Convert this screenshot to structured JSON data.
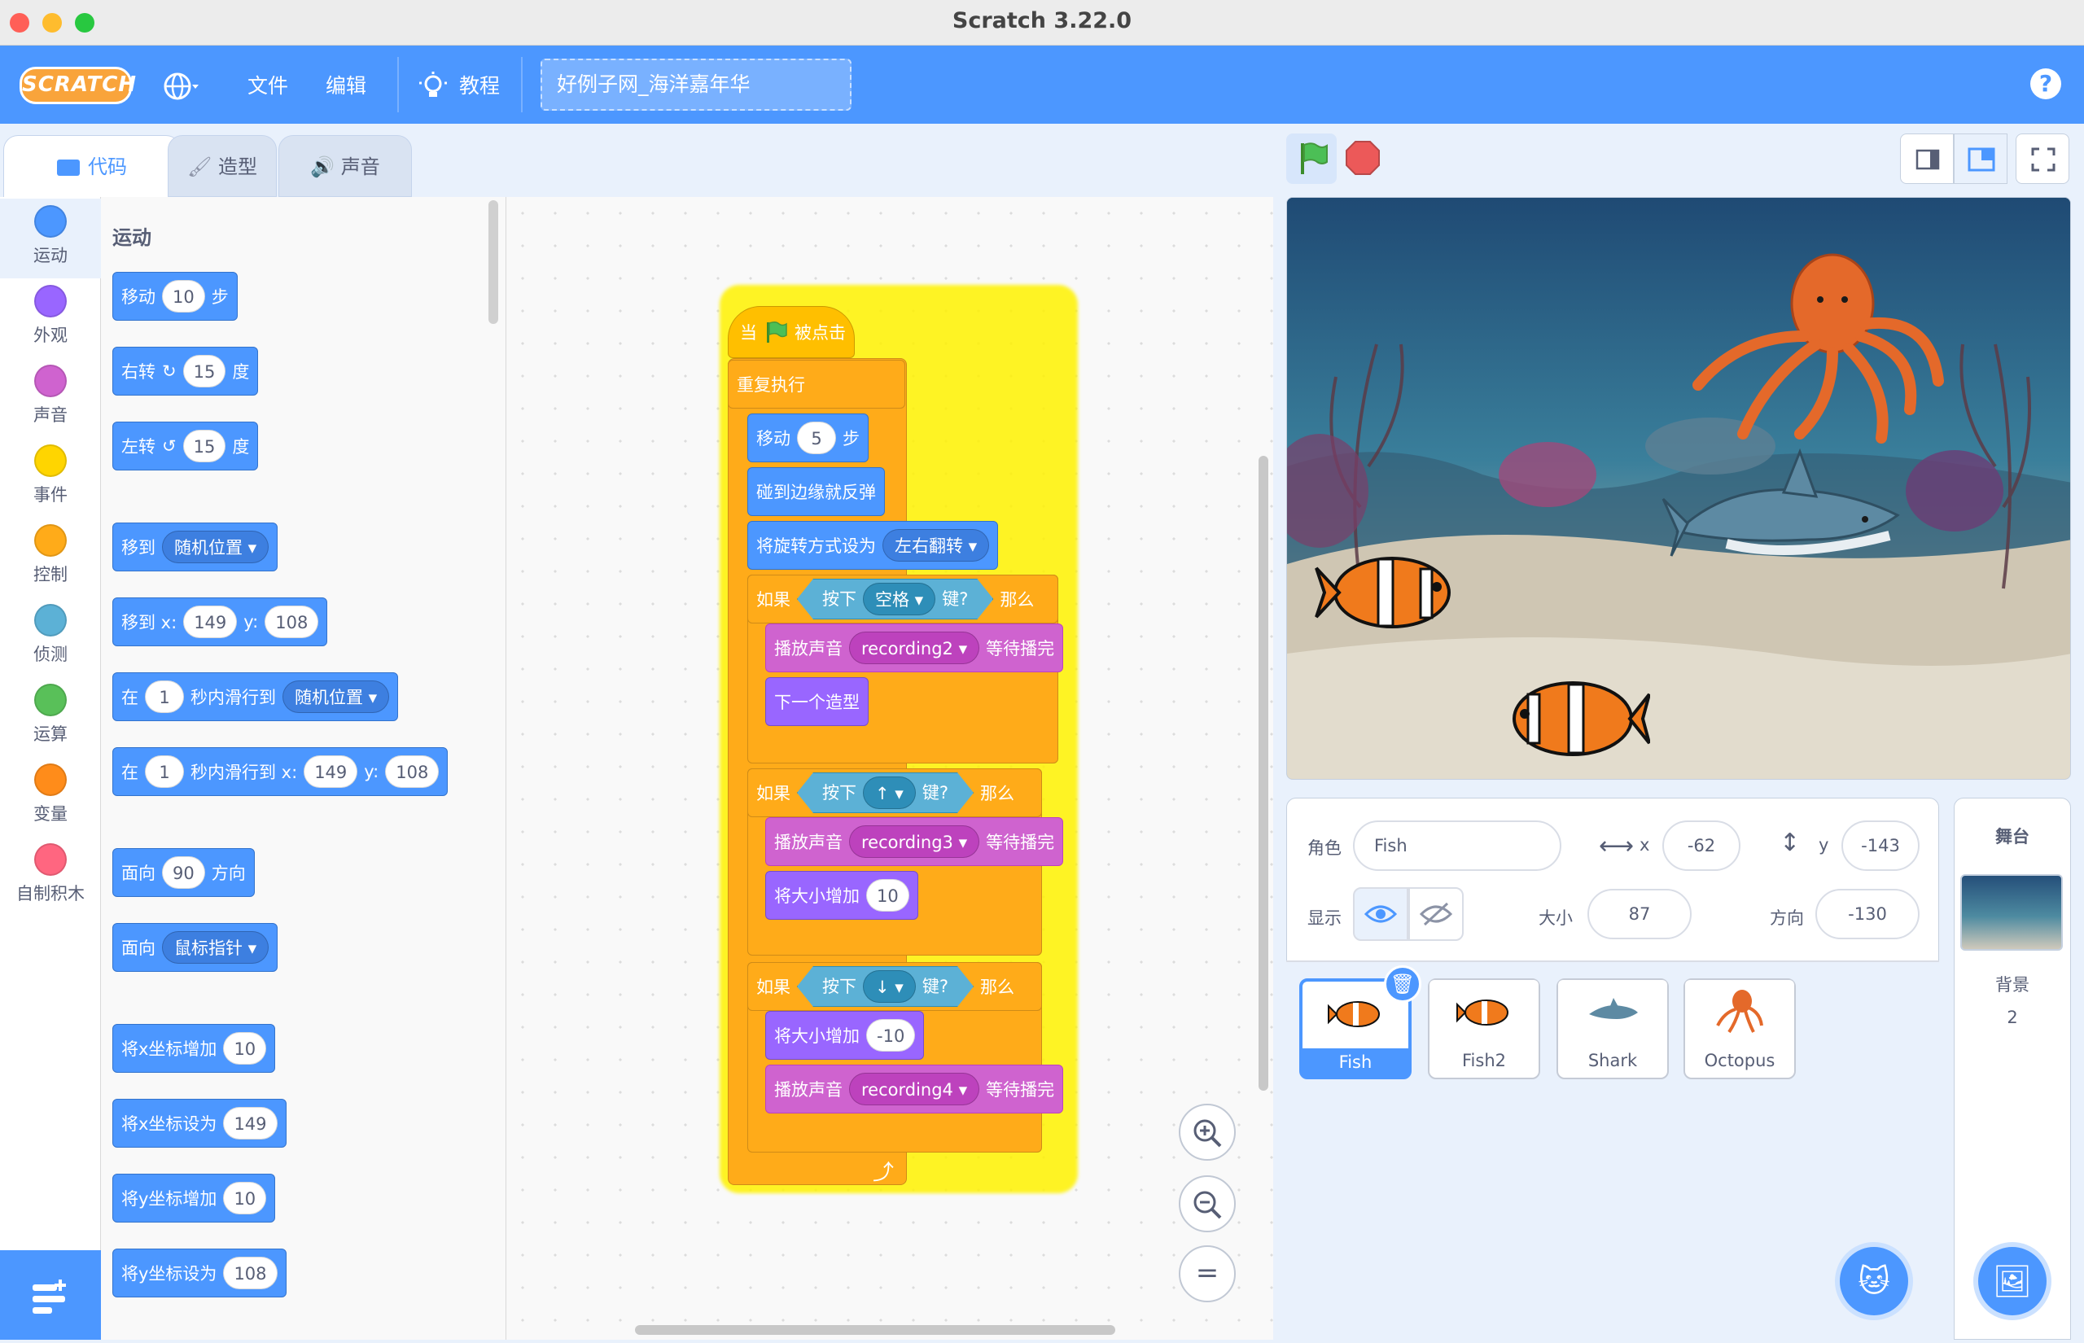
{
  "window": {
    "title": "Scratch 3.22.0"
  },
  "menu": {
    "logo_text": "SCRATCH",
    "language_icon": "globe-icon",
    "file": "文件",
    "edit": "编辑",
    "tutorials": "教程",
    "project_name": "好例子网_海洋嘉年华",
    "help": "?"
  },
  "tabs": {
    "code": "代码",
    "costumes": "造型",
    "sounds": "声音"
  },
  "categories": [
    {
      "label": "运动",
      "color": "#4c97ff"
    },
    {
      "label": "外观",
      "color": "#9966ff"
    },
    {
      "label": "声音",
      "color": "#cf63cf"
    },
    {
      "label": "事件",
      "color": "#ffd500"
    },
    {
      "label": "控制",
      "color": "#ffab19"
    },
    {
      "label": "侦测",
      "color": "#5cb1d6"
    },
    {
      "label": "运算",
      "color": "#59c059"
    },
    {
      "label": "变量",
      "color": "#ff8c1a"
    },
    {
      "label": "自制积木",
      "color": "#ff6680"
    }
  ],
  "palette": {
    "heading": "运动",
    "move": {
      "pre": "移动",
      "val": "10",
      "post": "步"
    },
    "turn_right": {
      "pre": "右转",
      "val": "15",
      "post": "度"
    },
    "turn_left": {
      "pre": "左转",
      "val": "15",
      "post": "度"
    },
    "goto": {
      "pre": "移到",
      "dd": "随机位置"
    },
    "goto_xy": {
      "pre": "移到 x:",
      "x": "149",
      "ylbl": "y:",
      "y": "108"
    },
    "glide": {
      "pre": "在",
      "secs": "1",
      "mid": "秒内滑行到",
      "dd": "随机位置"
    },
    "glide_xy": {
      "pre": "在",
      "secs": "1",
      "mid": "秒内滑行到 x:",
      "x": "149",
      "ylbl": "y:",
      "y": "108"
    },
    "point_dir": {
      "pre": "面向",
      "val": "90",
      "post": "方向"
    },
    "point_towards": {
      "pre": "面向",
      "dd": "鼠标指针"
    },
    "change_x": {
      "pre": "将x坐标增加",
      "val": "10"
    },
    "set_x": {
      "pre": "将x坐标设为",
      "val": "149"
    },
    "change_y": {
      "pre": "将y坐标增加",
      "val": "10"
    },
    "set_y": {
      "pre": "将y坐标设为",
      "val": "108"
    }
  },
  "script": {
    "hat": {
      "pre": "当",
      "post": "被点击"
    },
    "forever": "重复执行",
    "move": {
      "pre": "移动",
      "val": "5",
      "post": "步"
    },
    "bounce": "碰到边缘就反弹",
    "rotation": {
      "pre": "将旋转方式设为",
      "dd": "左右翻转"
    },
    "if1": {
      "if": "如果",
      "press": "按下",
      "key": "空格",
      "keysuf": "键?",
      "then": "那么",
      "sound": {
        "pre": "播放声音",
        "dd": "recording2",
        "post": "等待播完"
      },
      "next_costume": "下一个造型"
    },
    "if2": {
      "if": "如果",
      "press": "按下",
      "key": "↑",
      "keysuf": "键?",
      "then": "那么",
      "sound": {
        "pre": "播放声音",
        "dd": "recording3",
        "post": "等待播完"
      },
      "size": {
        "pre": "将大小增加",
        "val": "10"
      }
    },
    "if3": {
      "if": "如果",
      "press": "按下",
      "key": "↓",
      "keysuf": "键?",
      "then": "那么",
      "size": {
        "pre": "将大小增加",
        "val": "-10"
      },
      "sound": {
        "pre": "播放声音",
        "dd": "recording4",
        "post": "等待播完"
      }
    }
  },
  "zoom": {
    "in": "+",
    "out": "−",
    "reset": "="
  },
  "sprite_info": {
    "sprite_label": "角色",
    "sprite_name": "Fish",
    "x_label": "x",
    "x": "-62",
    "y_label": "y",
    "y": "-143",
    "show_label": "显示",
    "size_label": "大小",
    "size": "87",
    "direction_label": "方向",
    "direction": "-130"
  },
  "sprites": [
    {
      "name": "Fish",
      "selected": true
    },
    {
      "name": "Fish2",
      "selected": false
    },
    {
      "name": "Shark",
      "selected": false
    },
    {
      "name": "Octopus",
      "selected": false
    }
  ],
  "stage_pane": {
    "title": "舞台",
    "backdrop_label": "背景",
    "backdrop_count": "2"
  }
}
